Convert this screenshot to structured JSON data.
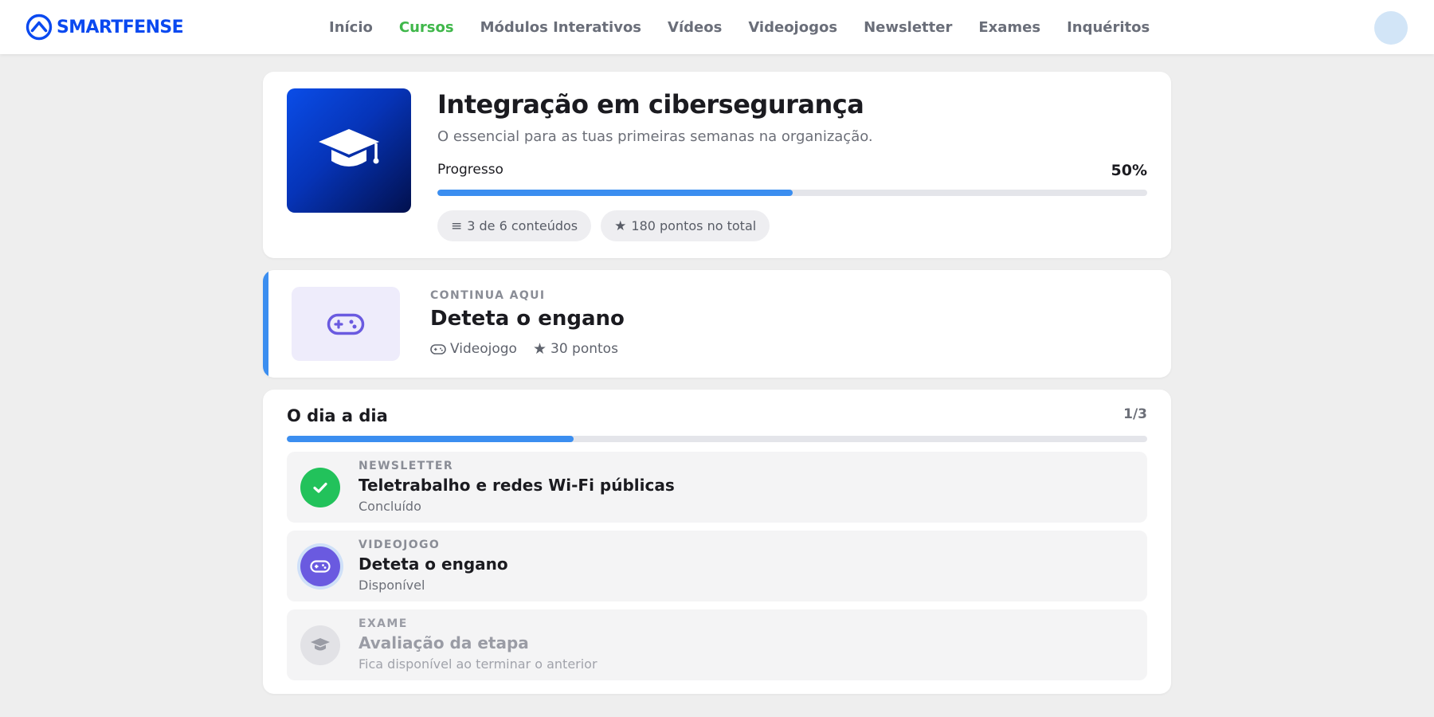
{
  "brand": {
    "name": "SMARTFENSE",
    "logo_icon": "smartfense-logo-icon",
    "color": "#0a49f0"
  },
  "nav": {
    "items": [
      "Início",
      "Cursos",
      "Módulos Interativos",
      "Vídeos",
      "Videojogos",
      "Newsletter",
      "Exames",
      "Inquéritos"
    ],
    "active": "Cursos",
    "active_color": "#3fb74a"
  },
  "course": {
    "title": "Integração em cibersegurança",
    "subtitle": "O essencial para as tuas primeiras semanas na organização.",
    "thumbnail_icon": "graduation-cap-icon",
    "progress_label": "Progresso",
    "progress_text": "50%",
    "progress_fraction": 0.5,
    "chips": {
      "contents": "3 de 6 conteúdos",
      "contents_icon": "list-icon",
      "points": "180 pontos no total",
      "points_icon": "star-icon"
    }
  },
  "continue": {
    "eyebrow": "CONTINUA AQUI",
    "title": "Deteta o engano",
    "type_label": "Videojogo",
    "type_icon": "gamepad-icon",
    "points_label": "30 pontos",
    "points_icon": "star-icon",
    "accent_color": "#3b8ef0"
  },
  "stage": {
    "title": "O dia a dia",
    "count_text": "1/3",
    "progress_fraction": 0.333,
    "items": [
      {
        "type": "NEWSLETTER",
        "title": "Teletrabalho e redes Wi-Fi públicas",
        "status": "Concluído",
        "state": "completed",
        "icon": "check-icon",
        "color": "#22c25b"
      },
      {
        "type": "VIDEOJOGO",
        "title": "Deteta o engano",
        "status": "Disponível",
        "state": "available",
        "icon": "gamepad-icon",
        "color": "#6a5ae0"
      },
      {
        "type": "EXAME",
        "title": "Avaliação da etapa",
        "status": "Fica disponível ao terminar o anterior",
        "state": "locked",
        "icon": "graduation-cap-icon",
        "color": "#e2e2e6"
      }
    ]
  }
}
